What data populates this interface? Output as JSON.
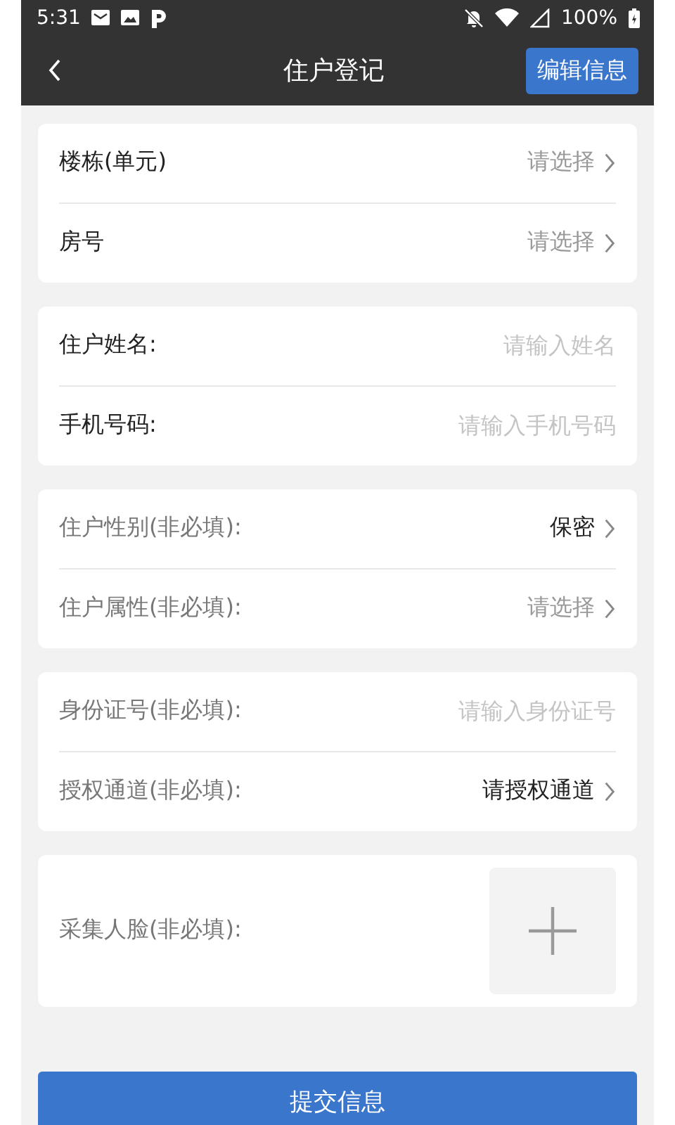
{
  "status_bar": {
    "time": "5:31",
    "battery": "100%"
  },
  "nav": {
    "title": "住户登记",
    "action": "编辑信息"
  },
  "sections": [
    {
      "rows": [
        {
          "kind": "select",
          "label": "楼栋(单元)",
          "optional": false,
          "placeholder": "请选择"
        },
        {
          "kind": "select",
          "label": "房号",
          "optional": false,
          "placeholder": "请选择"
        }
      ]
    },
    {
      "rows": [
        {
          "kind": "input",
          "label": "住户姓名:",
          "optional": false,
          "placeholder": "请输入姓名"
        },
        {
          "kind": "input",
          "label": "手机号码:",
          "optional": false,
          "placeholder": "请输入手机号码"
        }
      ]
    },
    {
      "rows": [
        {
          "kind": "select",
          "label": "住户性别(非必填):",
          "optional": true,
          "value": "保密"
        },
        {
          "kind": "select",
          "label": "住户属性(非必填):",
          "optional": true,
          "placeholder": "请选择"
        }
      ]
    },
    {
      "rows": [
        {
          "kind": "input",
          "label": "身份证号(非必填):",
          "optional": true,
          "placeholder": "请输入身份证号"
        },
        {
          "kind": "select",
          "label": "授权通道(非必填):",
          "optional": true,
          "value": "请授权通道"
        }
      ]
    },
    {
      "rows": [
        {
          "kind": "photo",
          "label": "采集人脸(非必填):",
          "optional": true
        }
      ]
    }
  ],
  "submit": "提交信息"
}
